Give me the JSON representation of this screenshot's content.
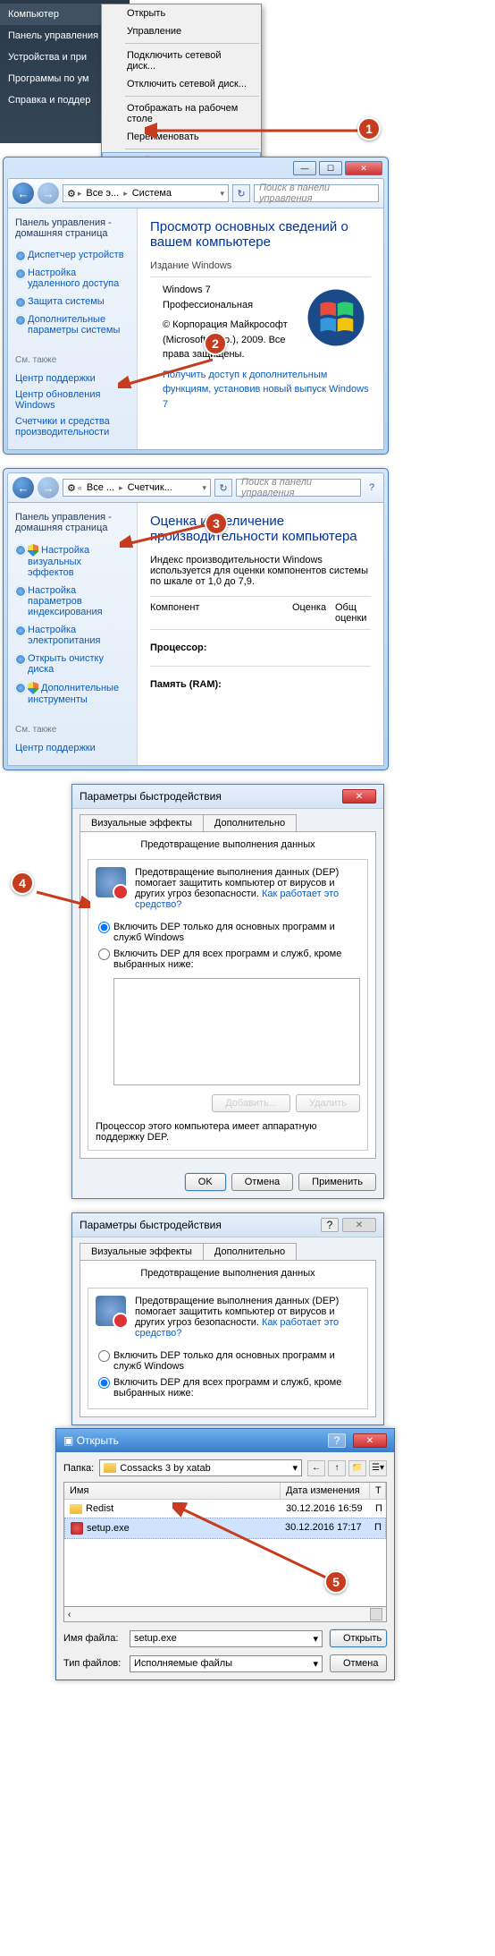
{
  "section1": {
    "startmenu": [
      "Компьютер",
      "Панель управления",
      "Устройства и при",
      "Программы по ум",
      "Справка и поддер"
    ],
    "context": {
      "items": [
        "Открыть",
        "Управление",
        "Подключить сетевой диск...",
        "Отключить сетевой диск...",
        "Отображать на рабочем столе",
        "Переименовать",
        "Свойства"
      ]
    }
  },
  "section2": {
    "breadcrumb": [
      "Все э...",
      "Система"
    ],
    "search_placeholder": "Поиск в панели управления",
    "sidebar_head": "Панель управления - домашняя страница",
    "sidebar_links": [
      "Диспетчер устройств",
      "Настройка удаленного доступа",
      "Защита системы",
      "Дополнительные параметры системы"
    ],
    "see_also_label": "См. также",
    "see_also": [
      "Центр поддержки",
      "Центр обновления Windows",
      "Счетчики и средства производительности"
    ],
    "title": "Просмотр основных сведений о вашем компьютере",
    "edition_label": "Издание Windows",
    "edition_rows": [
      "Windows 7 Профессиональная",
      "© Корпорация Майкрософт (Microsoft Corp.), 2009. Все права защищены."
    ],
    "feature_link": "Получить доступ к дополнительным функциям, установив новый выпуск Windows 7"
  },
  "section3": {
    "breadcrumb": [
      "Все ...",
      "Счетчик..."
    ],
    "search_placeholder": "Поиск в панели управления",
    "sidebar_head": "Панель управления - домашняя страница",
    "sidebar_links": [
      "Настройка визуальных эффектов",
      "Настройка параметров индексирования",
      "Настройка электропитания",
      "Открыть очистку диска",
      "Дополнительные инструменты"
    ],
    "see_also_label": "См. также",
    "see_also": [
      "Центр поддержки"
    ],
    "title": "Оценка и увеличение производительности компьютера",
    "desc": "Индекс производительности Windows используется для оценки компонентов системы по шкале от 1,0 до 7,9.",
    "col1": "Компонент",
    "col2": "Оценка",
    "col3": "Общ оценки",
    "rows": [
      "Процессор:",
      "Память (RAM):"
    ]
  },
  "section4": {
    "title": "Параметры быстродействия",
    "tabs": [
      "Визуальные эффекты",
      "Дополнительно",
      "Предотвращение выполнения данных"
    ],
    "dep_desc": "Предотвращение выполнения данных (DEP) помогает защитить компьютер от вирусов и других угроз безопасности.",
    "dep_link": "Как работает это средство?",
    "radio1": "Включить DEP только для основных программ и служб Windows",
    "radio2": "Включить DEP для всех программ и служб, кроме выбранных ниже:",
    "add": "Добавить...",
    "remove": "Удалить",
    "hw_note": "Процессор этого компьютера имеет аппаратную поддержку DEP.",
    "ok": "OK",
    "cancel": "Отмена",
    "apply": "Применить"
  },
  "section5": {
    "perfdlg_title": "Параметры быстродействия",
    "opendlg_title": "Открыть",
    "folder_label": "Папка:",
    "folder_value": "Cossacks 3 by xatab",
    "columns": [
      "Имя",
      "Дата изменения",
      "Т"
    ],
    "rows": [
      {
        "icon": "folder",
        "name": "Redist",
        "date": "30.12.2016 16:59",
        "type": "П"
      },
      {
        "icon": "exe",
        "name": "setup.exe",
        "date": "30.12.2016 17:17",
        "type": "П"
      }
    ],
    "scroll_hint": "‹",
    "filename_label": "Имя файла:",
    "filename_value": "setup.exe",
    "filetype_label": "Тип файлов:",
    "filetype_value": "Исполняемые файлы",
    "open": "Открыть",
    "cancel": "Отмена"
  }
}
